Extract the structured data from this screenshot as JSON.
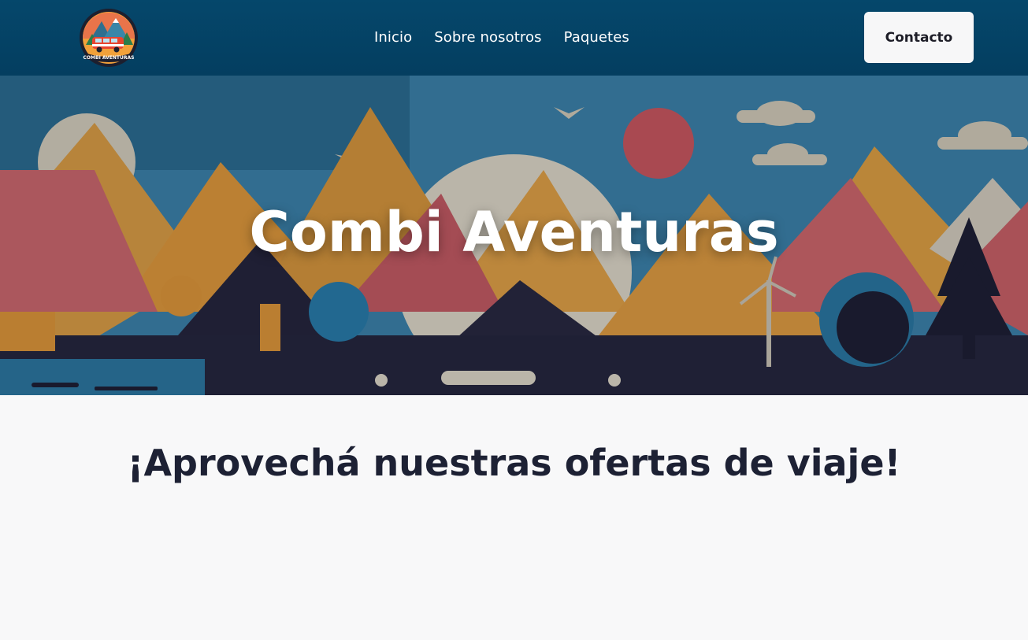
{
  "nav": {
    "logo_text": "COMBI AVENTURAS",
    "links": [
      {
        "label": "Inicio"
      },
      {
        "label": "Sobre nosotros"
      },
      {
        "label": "Paquetes"
      }
    ],
    "contact_label": "Contacto"
  },
  "hero": {
    "title": "Combi Aventuras"
  },
  "offers": {
    "heading": "¡Aprovechá nuestras ofertas de viaje!"
  },
  "colors": {
    "navbar": "#04476b",
    "hero_sky": "#3a7fa8",
    "mountain_orange": "#e59d3f",
    "mountain_pink": "#d16b72",
    "dark_navy": "#262740",
    "body_bg": "#f8f8f9",
    "heading": "#1d2134"
  }
}
